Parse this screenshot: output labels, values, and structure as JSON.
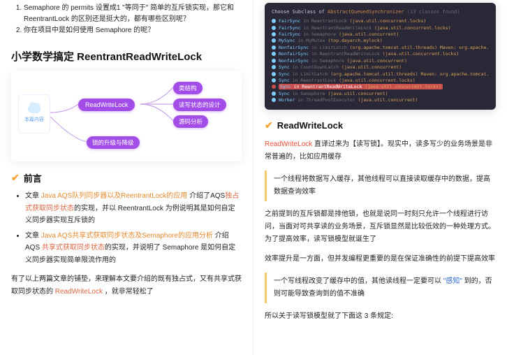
{
  "left": {
    "questions": [
      "Semaphore 的 permits 设置成1 \"等同于\" 简单的互斥锁实现，那它和 ReentrantLock 的区别还是挺大的，都有哪些区别呢？",
      "你在项目中是如何使用 Semaphore 的呢？"
    ],
    "title": "小学数学搞定 ReentrantReadWriteLock",
    "diagram": {
      "sideLabel": "本篇内容",
      "center": "ReadWriteLock",
      "leaves": [
        "类结构",
        "读写状态的设计",
        "源码分析"
      ],
      "bottom": "锁的升级与降级"
    },
    "sec_preface": "前言",
    "bullets": [
      {
        "prefix": "文章 ",
        "link": "Java AQS队列同步器以及ReentrantLock的应用",
        "mid": " 介绍了AQS",
        "link2": "独占式获取同步状态",
        "tail": "的实现，并以 ReentrantLock 为例说明其是如何自定义同步器实现互斥锁的"
      },
      {
        "prefix": "文章 ",
        "link": "Java AQS共享式获取同步状态及Semaphore的应用分析",
        "mid": " 介绍 AQS ",
        "link2": "共享式获取同步状态",
        "tail": "的实现，并说明了 Semaphore 是如何自定义同步器实现简单限流作用的"
      }
    ],
    "para_bridge_a": "有了以上两篇文章的铺垫，来理解本文要介绍的既有独占式，又有共享式获取同步状态的 ",
    "para_bridge_link": "ReadWriteLock",
    "para_bridge_b": " ，就非常轻松了"
  },
  "right": {
    "code": {
      "head_a": "Choose Subclass of ",
      "head_b": "AbstractQueuedSynchronizer",
      "head_c": " (13 classes found)",
      "rows": [
        {
          "dot": "#7dcfff",
          "a": "FairSync",
          "b": " in ReentrantLock ",
          "c": "(java.util.concurrent.locks)"
        },
        {
          "dot": "#7dcfff",
          "a": "FairSync",
          "b": " in ReentrantReadWriteLock ",
          "c": "(java.util.concurrent.locks)"
        },
        {
          "dot": "#7dcfff",
          "a": "FairSync",
          "b": " in Semaphore ",
          "c": "(java.util.concurrent)"
        },
        {
          "dot": "#7dcfff",
          "a": "MySync",
          "b": " in MyMutex ",
          "c": "(top.dayarch.mylock)"
        },
        {
          "dot": "#7dcfff",
          "a": "NonfairSync",
          "b": " in LimitLatch ",
          "c": "(org.apache.tomcat.util.threads)  Maven: org.apache.tomcat.embe"
        },
        {
          "dot": "#7dcfff",
          "a": "NonfairSync",
          "b": " in ReentrantReadWriteLock ",
          "c": "(java.util.concurrent.locks)"
        },
        {
          "dot": "#7dcfff",
          "a": "NonfairSync",
          "b": " in Semaphore ",
          "c": "(java.util.concurrent)"
        },
        {
          "dot": "#7dcfff",
          "a": "Sync",
          "b": " in CountDownLatch ",
          "c": "(java.util.concurrent)"
        },
        {
          "dot": "#7dcfff",
          "a": "Sync",
          "b": " in LimitLatch ",
          "c": "(org.apache.tomcat.util.threads)  Maven: org.apache.tomcat.embe"
        },
        {
          "dot": "#7dcfff",
          "a": "Sync",
          "b": " in ReentrantLock ",
          "c": "(java.util.concurrent.locks)"
        },
        {
          "dot": "#c94f4f",
          "hl": true,
          "a": "Sync",
          "b": " in ReentrantReadWriteLock ",
          "c": "(java.util.concurrent.locks)"
        },
        {
          "dot": "#7dcfff",
          "a": "Sync",
          "b": " in Semaphore ",
          "c": "(java.util.concurrent)"
        },
        {
          "dot": "#7dcfff",
          "a": "Worker",
          "b": " in ThreadPoolExecutor ",
          "c": "(java.util.concurrent)"
        }
      ]
    },
    "sec_rwl": "ReadWriteLock",
    "p1_a": "ReadWriteLock",
    "p1_b": " 直译过来为【读写锁】。现实中，读多写少的业务场景是非常普遍的，比如应用缓存",
    "quote1": "一个线程将数据写入缓存，其他线程可以直接读取缓存中的数据，提高数据查询效率",
    "p2": "之前提到的互斥锁都是排他锁，也就是说同一时刻只允许一个线程进行访问，当面对可共享读的业务场景，互斥锁显然是比较低效的一种处理方式。为了提高效率，读写锁模型就诞生了",
    "p3": "效率提升是一方面，但并发编程更重要的是在保证准确性的前提下提高效率",
    "quote2_a": "一个写线程改变了缓存中的值，其他读线程一定要可以 ",
    "quote2_b": "\"感知\"",
    "quote2_c": " 到的，否则可能导致查询到的值不准确",
    "p4": "所以关于读写锁模型就了下面这 3 条规定:"
  }
}
